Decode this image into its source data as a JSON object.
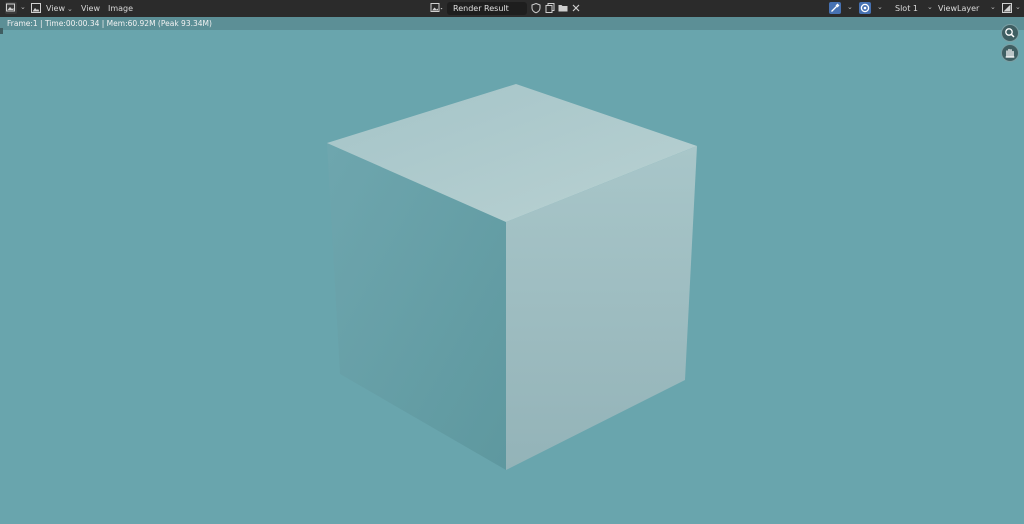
{
  "header": {
    "editor_type_icon": "image-editor-icon",
    "view_menu_icon": "image-view-icon",
    "menus": [
      {
        "label": "View"
      },
      {
        "label": "View"
      },
      {
        "label": "Image"
      }
    ],
    "image_name": "Render Result",
    "image_actions": [
      {
        "icon": "shield-icon"
      },
      {
        "icon": "duplicate-icon"
      },
      {
        "icon": "folder-icon"
      },
      {
        "icon": "close-icon"
      }
    ],
    "slot": "Slot 1",
    "view_layer": "ViewLayer"
  },
  "metadata": {
    "text": "Frame:1 | Time:00:00.34 | Mem:60.92M (Peak 93.34M)"
  },
  "colors": {
    "background": "#69a5ad",
    "header": "#2b2b2b",
    "accent": "#4772b3"
  }
}
